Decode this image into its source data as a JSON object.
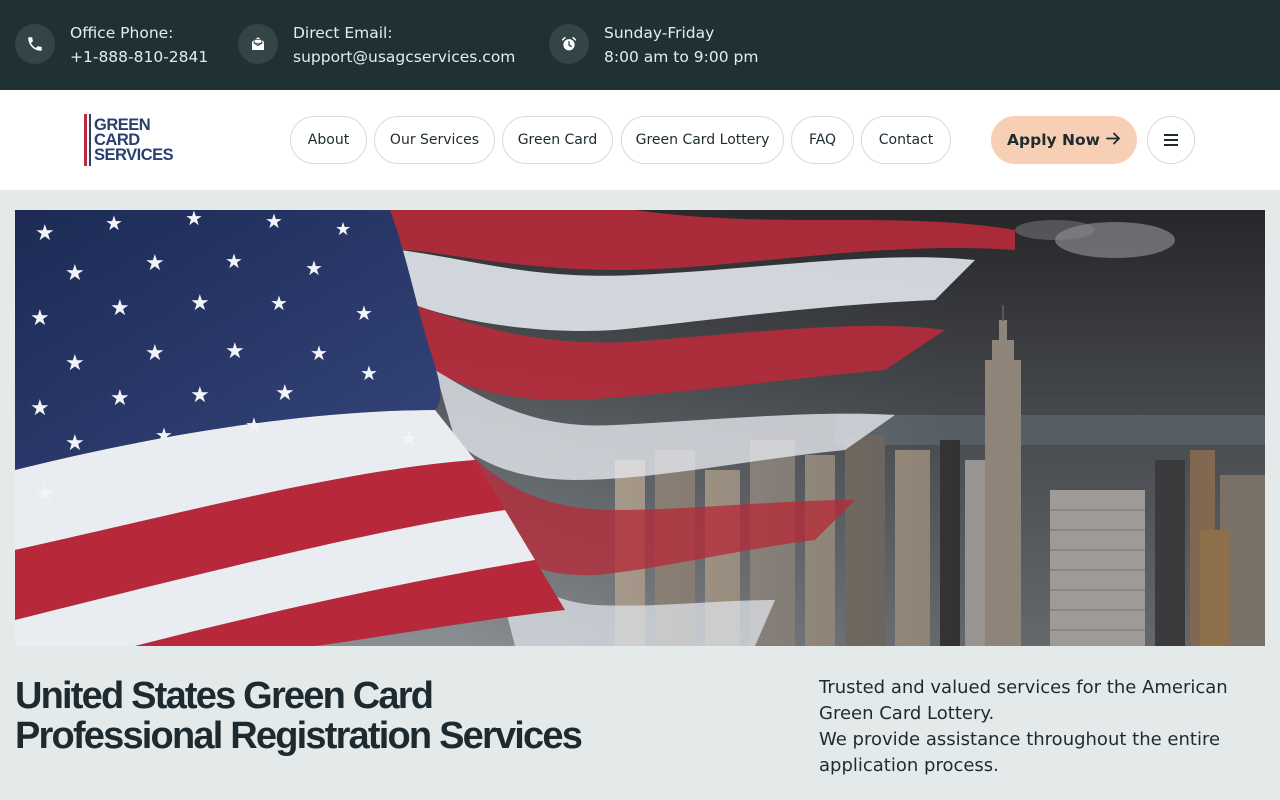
{
  "topbar": {
    "phone": {
      "label": "Office Phone:",
      "value": "+1-888-810-2841",
      "icon": "phone-icon"
    },
    "email": {
      "label": "Direct Email:",
      "value": "support@usagcservices.com",
      "icon": "mail-icon"
    },
    "hours": {
      "label": "Sunday-Friday",
      "value": "8:00 am to 9:00 pm",
      "icon": "alarm-clock-icon"
    }
  },
  "logo": {
    "line1": "GREEN",
    "line2": "CARD",
    "line3": "SERVICES"
  },
  "nav": {
    "items": [
      {
        "label": "About"
      },
      {
        "label": "Our Services"
      },
      {
        "label": "Green Card"
      },
      {
        "label": "Green Card Lottery"
      },
      {
        "label": "FAQ"
      },
      {
        "label": "Contact"
      }
    ],
    "apply_label": "Apply Now",
    "apply_icon": "arrow-right-icon",
    "menu_icon": "hamburger-menu-icon"
  },
  "hero": {
    "image": "american-flag-over-new-york-city-skyline"
  },
  "headline": {
    "line1": "United States Green Card",
    "line2": "Professional Registration Services"
  },
  "description": {
    "line1": "Trusted and valued services for the American",
    "line2": "Green Card Lottery.",
    "line3": "We provide assistance throughout the entire",
    "line4": "application process."
  },
  "colors": {
    "topbar_bg": "#1f3133",
    "page_bg": "#e4eaea",
    "accent_button": "#f6cfb5",
    "logo_blue": "#2a3f6e",
    "logo_red": "#c0273d"
  }
}
